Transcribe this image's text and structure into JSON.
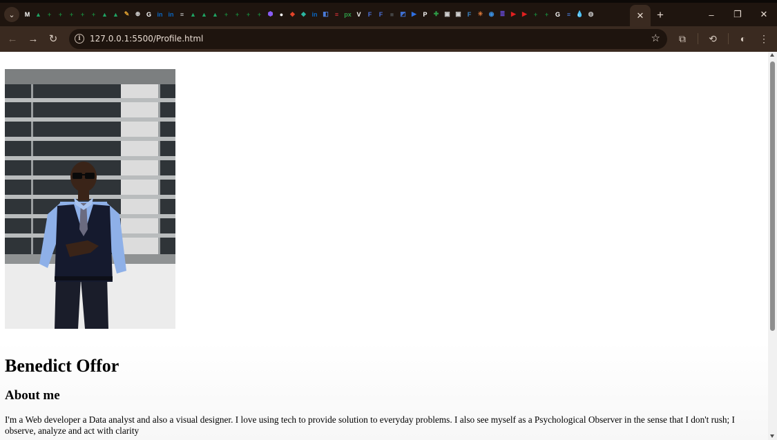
{
  "browser": {
    "tab_favicons": [
      {
        "icon": "mail-icon",
        "color": "#ffffff",
        "glyph": "M"
      },
      {
        "icon": "drive-icon",
        "color": "#1fa463",
        "glyph": "▲"
      },
      {
        "icon": "sheets-icon",
        "color": "#188038",
        "glyph": "+"
      },
      {
        "icon": "sheets-icon",
        "color": "#188038",
        "glyph": "+"
      },
      {
        "icon": "sheets-icon",
        "color": "#188038",
        "glyph": "+"
      },
      {
        "icon": "sheets-icon",
        "color": "#188038",
        "glyph": "+"
      },
      {
        "icon": "sheets-icon",
        "color": "#188038",
        "glyph": "+"
      },
      {
        "icon": "drive-icon",
        "color": "#1fa463",
        "glyph": "▲"
      },
      {
        "icon": "drive-icon",
        "color": "#1fa463",
        "glyph": "▲"
      },
      {
        "icon": "notes-icon",
        "color": "#e0a030",
        "glyph": "✎"
      },
      {
        "icon": "chatgpt-icon",
        "color": "#dddddd",
        "glyph": "⊛"
      },
      {
        "icon": "google-icon",
        "color": "#ffffff",
        "glyph": "G"
      },
      {
        "icon": "linkedin-icon",
        "color": "#0a66c2",
        "glyph": "in"
      },
      {
        "icon": "linkedin-icon",
        "color": "#0a66c2",
        "glyph": "in"
      },
      {
        "icon": "forms-icon",
        "color": "#cccccc",
        "glyph": "≡"
      },
      {
        "icon": "drive-icon",
        "color": "#1fa463",
        "glyph": "▲"
      },
      {
        "icon": "drive-icon",
        "color": "#1fa463",
        "glyph": "▲"
      },
      {
        "icon": "drive-icon",
        "color": "#1fa463",
        "glyph": "▲"
      },
      {
        "icon": "sheets-icon",
        "color": "#188038",
        "glyph": "+"
      },
      {
        "icon": "sheets-icon",
        "color": "#188038",
        "glyph": "+"
      },
      {
        "icon": "sheets-icon",
        "color": "#188038",
        "glyph": "+"
      },
      {
        "icon": "sheets-icon",
        "color": "#188038",
        "glyph": "+"
      },
      {
        "icon": "cube-icon",
        "color": "#8a5cf6",
        "glyph": "⬢"
      },
      {
        "icon": "github-icon",
        "color": "#ffffff",
        "glyph": "●"
      },
      {
        "icon": "gitlab-icon",
        "color": "#e24329",
        "glyph": "◆"
      },
      {
        "icon": "diamond-icon",
        "color": "#2bb5a0",
        "glyph": "◆"
      },
      {
        "icon": "linkedin-icon",
        "color": "#0a66c2",
        "glyph": "in"
      },
      {
        "icon": "puzzle-icon",
        "color": "#4a7bd8",
        "glyph": "◧"
      },
      {
        "icon": "news-icon",
        "color": "#e0323a",
        "glyph": "≡"
      },
      {
        "icon": "px-icon",
        "color": "#2e9d47",
        "glyph": "px"
      },
      {
        "icon": "v-icon",
        "color": "#ffffff",
        "glyph": "V"
      },
      {
        "icon": "forms-icon",
        "color": "#4a6fd8",
        "glyph": "F"
      },
      {
        "icon": "forms-icon",
        "color": "#4a6fd8",
        "glyph": "F"
      },
      {
        "icon": "square-icon",
        "color": "#444444",
        "glyph": "■"
      },
      {
        "icon": "photo-icon",
        "color": "#3f6fd0",
        "glyph": "◩"
      },
      {
        "icon": "video-icon",
        "color": "#2f6fe0",
        "glyph": "▶"
      },
      {
        "icon": "p-icon",
        "color": "#ffffff",
        "glyph": "P"
      },
      {
        "icon": "plus-icon",
        "color": "#2e9d47",
        "glyph": "✚"
      },
      {
        "icon": "image-icon",
        "color": "#d0d0d0",
        "glyph": "▣"
      },
      {
        "icon": "image-icon",
        "color": "#d0d0d0",
        "glyph": "▣"
      },
      {
        "icon": "f-icon",
        "color": "#3a86c8",
        "glyph": "F"
      },
      {
        "icon": "spark-icon",
        "color": "#e07a3a",
        "glyph": "✳"
      },
      {
        "icon": "circle-icon",
        "color": "#3a8ee0",
        "glyph": "◉"
      },
      {
        "icon": "list-icon",
        "color": "#6a4ce0",
        "glyph": "≣"
      },
      {
        "icon": "youtube-icon",
        "color": "#e02020",
        "glyph": "▶"
      },
      {
        "icon": "youtube-icon",
        "color": "#e02020",
        "glyph": "▶"
      },
      {
        "icon": "sheets-icon",
        "color": "#188038",
        "glyph": "+"
      },
      {
        "icon": "sheets-icon",
        "color": "#188038",
        "glyph": "+"
      },
      {
        "icon": "google-icon",
        "color": "#ffffff",
        "glyph": "G"
      },
      {
        "icon": "docs-icon",
        "color": "#4a7bd8",
        "glyph": "≡"
      },
      {
        "icon": "drop-icon",
        "color": "#3a7ad8",
        "glyph": "💧"
      },
      {
        "icon": "globe-icon",
        "color": "#bbbbbb",
        "glyph": "◍"
      }
    ],
    "url": "127.0.0.1:5500/Profile.html"
  },
  "page": {
    "name": "Benedict Offor",
    "about_heading": "About me",
    "bio": "I'm a Web developer a Data analyst and also a visual designer. I love using tech to provide solution to everyday problems. I also see myself as a Psychological Observer in the sense that I don't rush; I observe, analyze and act with clarity"
  }
}
